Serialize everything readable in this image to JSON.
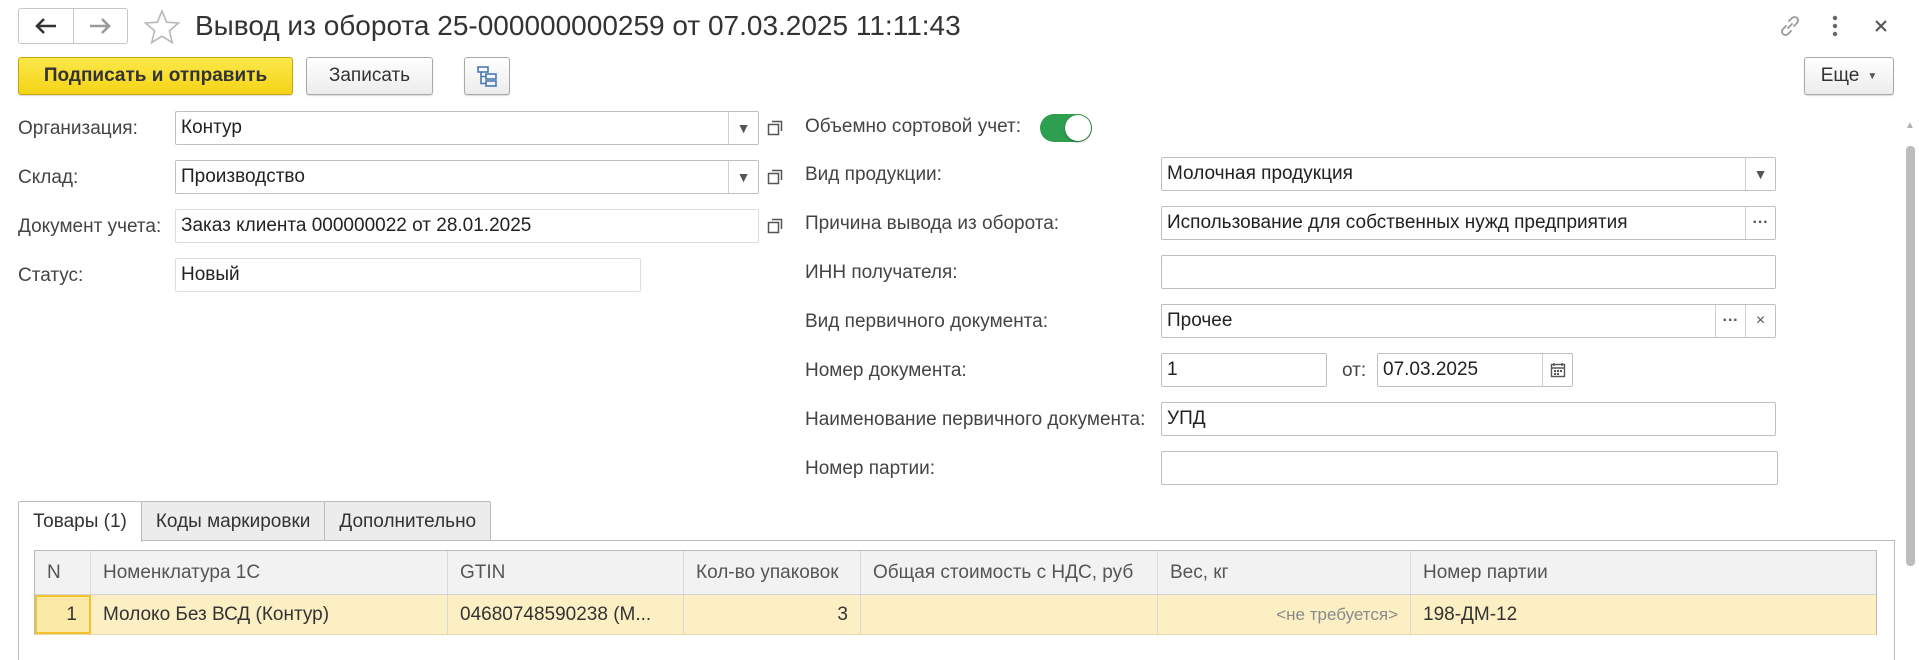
{
  "window": {
    "title": "Вывод из оборота 25-000000000259 от 07.03.2025 11:11:43",
    "nav": [
      "back-icon",
      "forward-icon"
    ],
    "favorite_icon": "star-icon",
    "top_icons": [
      "link-icon",
      "more-vert-icon",
      "close-icon"
    ]
  },
  "toolbar": {
    "sign_send_label": "Подписать и отправить",
    "save_label": "Записать",
    "structure_icon": "structure-icon",
    "more_label": "Еще"
  },
  "form_left": {
    "organization": {
      "label": "Организация:",
      "value": "Контур"
    },
    "warehouse": {
      "label": "Склад:",
      "value": "Производство"
    },
    "document": {
      "label": "Документ учета:",
      "value": "Заказ клиента 000000022 от 28.01.2025"
    },
    "status": {
      "label": "Статус:",
      "value": "Новый"
    }
  },
  "form_right": {
    "volume_sort": {
      "label": "Объемно сортовой учет:",
      "on": true
    },
    "product_type": {
      "label": "Вид продукции:",
      "value": "Молочная продукция"
    },
    "reason": {
      "label": "Причина вывода из оборота:",
      "value": "Использование для собственных нужд предприятия"
    },
    "inn": {
      "label": "ИНН получателя:",
      "value": ""
    },
    "primary_doc_type": {
      "label": "Вид первичного документа:",
      "value": "Прочее"
    },
    "doc_number": {
      "label": "Номер документа:",
      "value": "1",
      "date_label": "от:",
      "date_value": "07.03.2025"
    },
    "primary_doc_name": {
      "label": "Наименование первичного документа:",
      "value": "УПД"
    },
    "batch_number": {
      "label": "Номер партии:",
      "value": ""
    }
  },
  "tabs": [
    {
      "label": "Товары (1)",
      "active": true
    },
    {
      "label": "Коды маркировки",
      "active": false
    },
    {
      "label": "Дополнительно",
      "active": false
    }
  ],
  "table": {
    "columns": [
      "N",
      "Номенклатура 1С",
      "GTIN",
      "Кол-во упаковок",
      "Общая стоимость с НДС, руб",
      "Вес, кг",
      "Номер партии"
    ],
    "rows": [
      [
        "1",
        "Молоко Без ВСД (Контур)",
        "04680748590238 (М...",
        "3",
        "",
        "<не требуется>",
        "198-ДМ-12"
      ]
    ]
  },
  "colors": {
    "accent_yellow": "#f5d417",
    "toggle_green": "#2e9e4f",
    "row_highlight": "#fcefc4"
  }
}
